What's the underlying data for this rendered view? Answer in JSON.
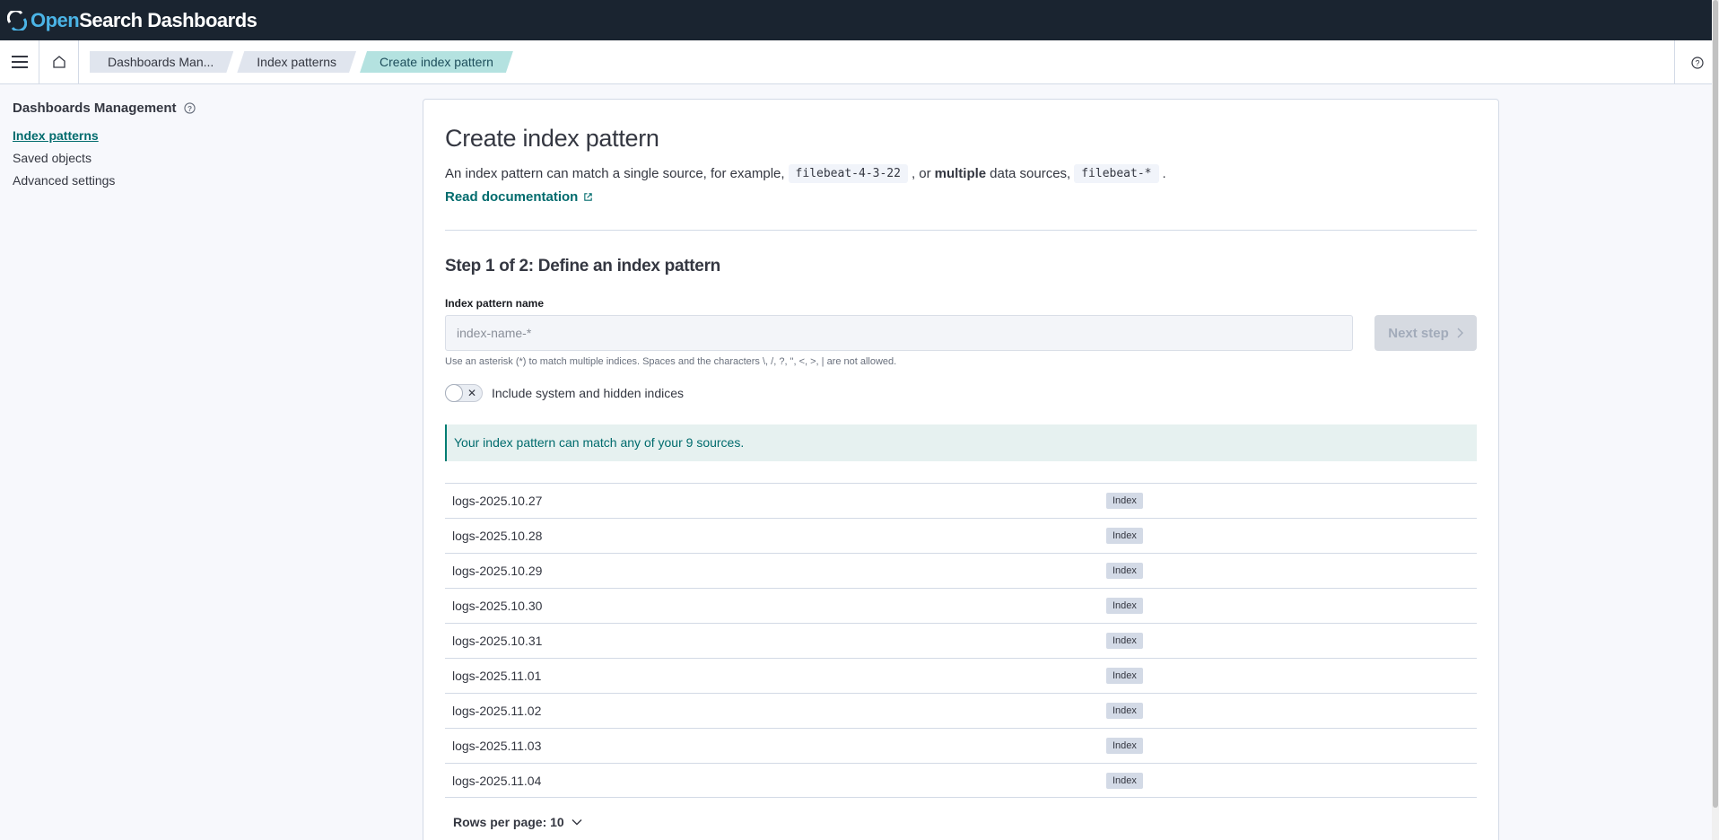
{
  "app": {
    "logo_open": "Open",
    "logo_rest": "Search Dashboards"
  },
  "breadcrumbs": [
    {
      "label": "Dashboards Man..."
    },
    {
      "label": "Index patterns"
    },
    {
      "label": "Create index pattern"
    }
  ],
  "sidebar": {
    "title": "Dashboards Management",
    "items": [
      {
        "label": "Index patterns",
        "active": true
      },
      {
        "label": "Saved objects"
      },
      {
        "label": "Advanced settings"
      }
    ]
  },
  "main": {
    "title": "Create index pattern",
    "desc_part1": "An index pattern can match a single source, for example,",
    "example1": "filebeat-4-3-22",
    "desc_part2": ", or",
    "desc_bold": "multiple",
    "desc_part3": "data sources,",
    "example2": "filebeat-*",
    "desc_end": ".",
    "doc_link": "Read documentation",
    "step_title": "Step 1 of 2: Define an index pattern",
    "field_label": "Index pattern name",
    "input_placeholder": "index-name-*",
    "input_value": "",
    "next_button": "Next step",
    "help_text": "Use an asterisk (*) to match multiple indices. Spaces and the characters \\, /, ?, \", <, >, | are not allowed.",
    "toggle_label": "Include system and hidden indices",
    "toggle_on": false,
    "callout": "Your index pattern can match any of your 9 sources.",
    "rows": [
      {
        "name": "logs-2025.10.27",
        "type": "Index"
      },
      {
        "name": "logs-2025.10.28",
        "type": "Index"
      },
      {
        "name": "logs-2025.10.29",
        "type": "Index"
      },
      {
        "name": "logs-2025.10.30",
        "type": "Index"
      },
      {
        "name": "logs-2025.10.31",
        "type": "Index"
      },
      {
        "name": "logs-2025.11.01",
        "type": "Index"
      },
      {
        "name": "logs-2025.11.02",
        "type": "Index"
      },
      {
        "name": "logs-2025.11.03",
        "type": "Index"
      },
      {
        "name": "logs-2025.11.04",
        "type": "Index"
      }
    ],
    "rows_per_page": "Rows per page: 10"
  },
  "colors": {
    "header_bg": "#1a2430",
    "accent": "#006b6d",
    "breadcrumb_active": "#b4e2e0"
  }
}
